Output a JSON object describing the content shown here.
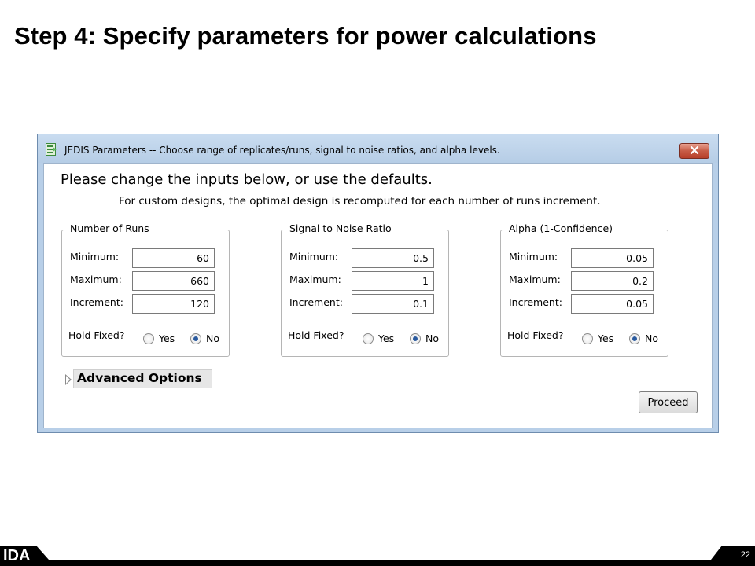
{
  "slide": {
    "title": "Step 4: Specify parameters for power calculations",
    "page_number": "22",
    "logo_text": "IDA"
  },
  "window": {
    "title": "JEDIS Parameters -- Choose range of replicates/runs, signal to noise ratios, and alpha levels.",
    "heading": "Please change the inputs below, or use the defaults.",
    "subheading": "For custom designs, the optimal design is recomputed for each number of runs increment."
  },
  "groups": [
    {
      "legend": "Number of Runs",
      "minimum_label": "Minimum:",
      "minimum": "60",
      "maximum_label": "Maximum:",
      "maximum": "660",
      "increment_label": "Increment:",
      "increment": "120",
      "hold_label": "Hold Fixed?",
      "yes_label": "Yes",
      "no_label": "No",
      "selected": "No"
    },
    {
      "legend": "Signal to Noise Ratio",
      "minimum_label": "Minimum:",
      "minimum": "0.5",
      "maximum_label": "Maximum:",
      "maximum": "1",
      "increment_label": "Increment:",
      "increment": "0.1",
      "hold_label": "Hold Fixed?",
      "yes_label": "Yes",
      "no_label": "No",
      "selected": "No"
    },
    {
      "legend": "Alpha (1-Confidence)",
      "minimum_label": "Minimum:",
      "minimum": "0.05",
      "maximum_label": "Maximum:",
      "maximum": "0.2",
      "increment_label": "Increment:",
      "increment": "0.05",
      "hold_label": "Hold Fixed?",
      "yes_label": "Yes",
      "no_label": "No",
      "selected": "No"
    }
  ],
  "advanced_options_label": "Advanced Options",
  "proceed_label": "Proceed",
  "colors": {
    "window_border": "#b8cfe8",
    "close_button": "#c75b45",
    "radio_selected": "#2a5a9e"
  },
  "icons": [
    "jmp-app-icon",
    "close-icon",
    "disclosure-triangle-icon"
  ]
}
